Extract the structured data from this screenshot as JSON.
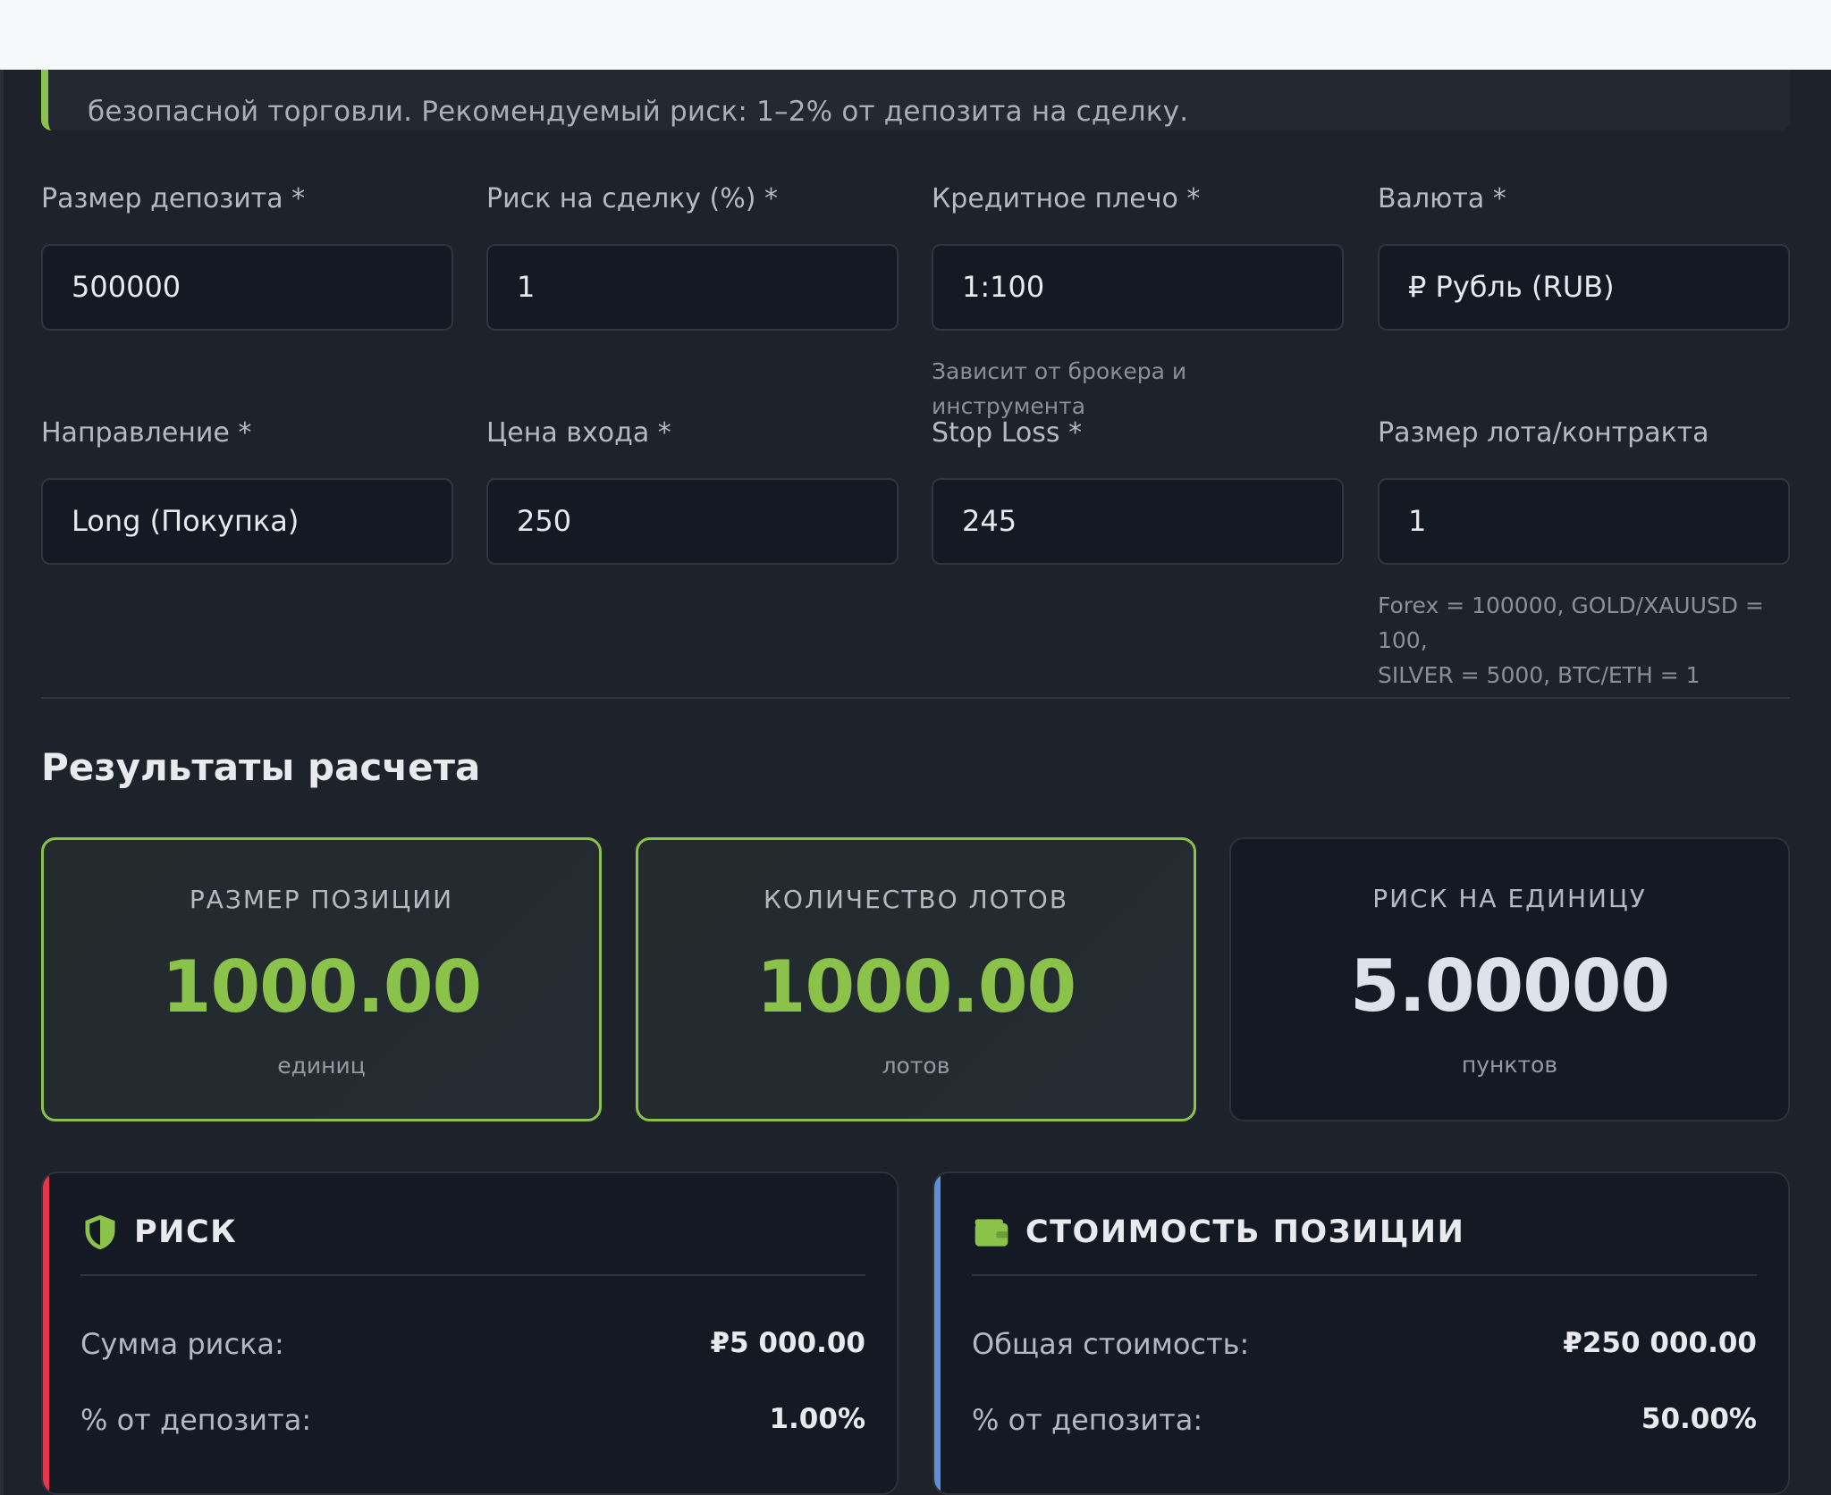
{
  "info_note": {
    "text": "безопасной торговли. Рекомендуемый риск: 1–2% от депозита на сделку."
  },
  "form": {
    "deposit": {
      "label": "Размер депозита *",
      "value": "500000"
    },
    "risk_pct": {
      "label": "Риск на сделку (%) *",
      "value": "1"
    },
    "leverage": {
      "label": "Кредитное плечо *",
      "value": "1:100",
      "hint": "Зависит от брокера и инструмента"
    },
    "currency": {
      "label": "Валюта *",
      "value": "₽ Рубль (RUB)"
    },
    "direction": {
      "label": "Направление *",
      "value": "Long (Покупка)"
    },
    "entry_price": {
      "label": "Цена входа *",
      "value": "250"
    },
    "stop_loss": {
      "label": "Stop Loss *",
      "value": "245"
    },
    "lot_size": {
      "label": "Размер лота/контракта",
      "value": "1",
      "hint_line1": "Forex = 100000, GOLD/XAUUSD = 100,",
      "hint_line2": "SILVER = 5000, BTC/ETH = 1"
    }
  },
  "results": {
    "title": "Результаты расчета",
    "position_size": {
      "label": "РАЗМЕР ПОЗИЦИИ",
      "value": "1000.00",
      "unit": "единиц"
    },
    "lots": {
      "label": "КОЛИЧЕСТВО ЛОТОВ",
      "value": "1000.00",
      "unit": "лотов"
    },
    "risk_per_unit": {
      "label": "РИСК НА ЕДИНИЦУ",
      "value": "5.00000",
      "unit": "пунктов"
    }
  },
  "risk_panel": {
    "title": "РИСК",
    "icon": "shield-icon",
    "rows": [
      {
        "key": "Сумма риска:",
        "value": "₽5 000.00"
      },
      {
        "key": "% от депозита:",
        "value": "1.00%"
      }
    ]
  },
  "value_panel": {
    "title": "СТОИМОСТЬ ПОЗИЦИИ",
    "icon": "wallet-icon",
    "rows": [
      {
        "key": "Общая стоимость:",
        "value": "₽250 000.00"
      },
      {
        "key": "% от депозита:",
        "value": "50.00%"
      }
    ]
  },
  "colors": {
    "accent_green": "#8bc34a",
    "risk_red": "#e5374b",
    "value_blue": "#5b8fd6",
    "background": "#1e222b",
    "input_bg": "#141923"
  }
}
